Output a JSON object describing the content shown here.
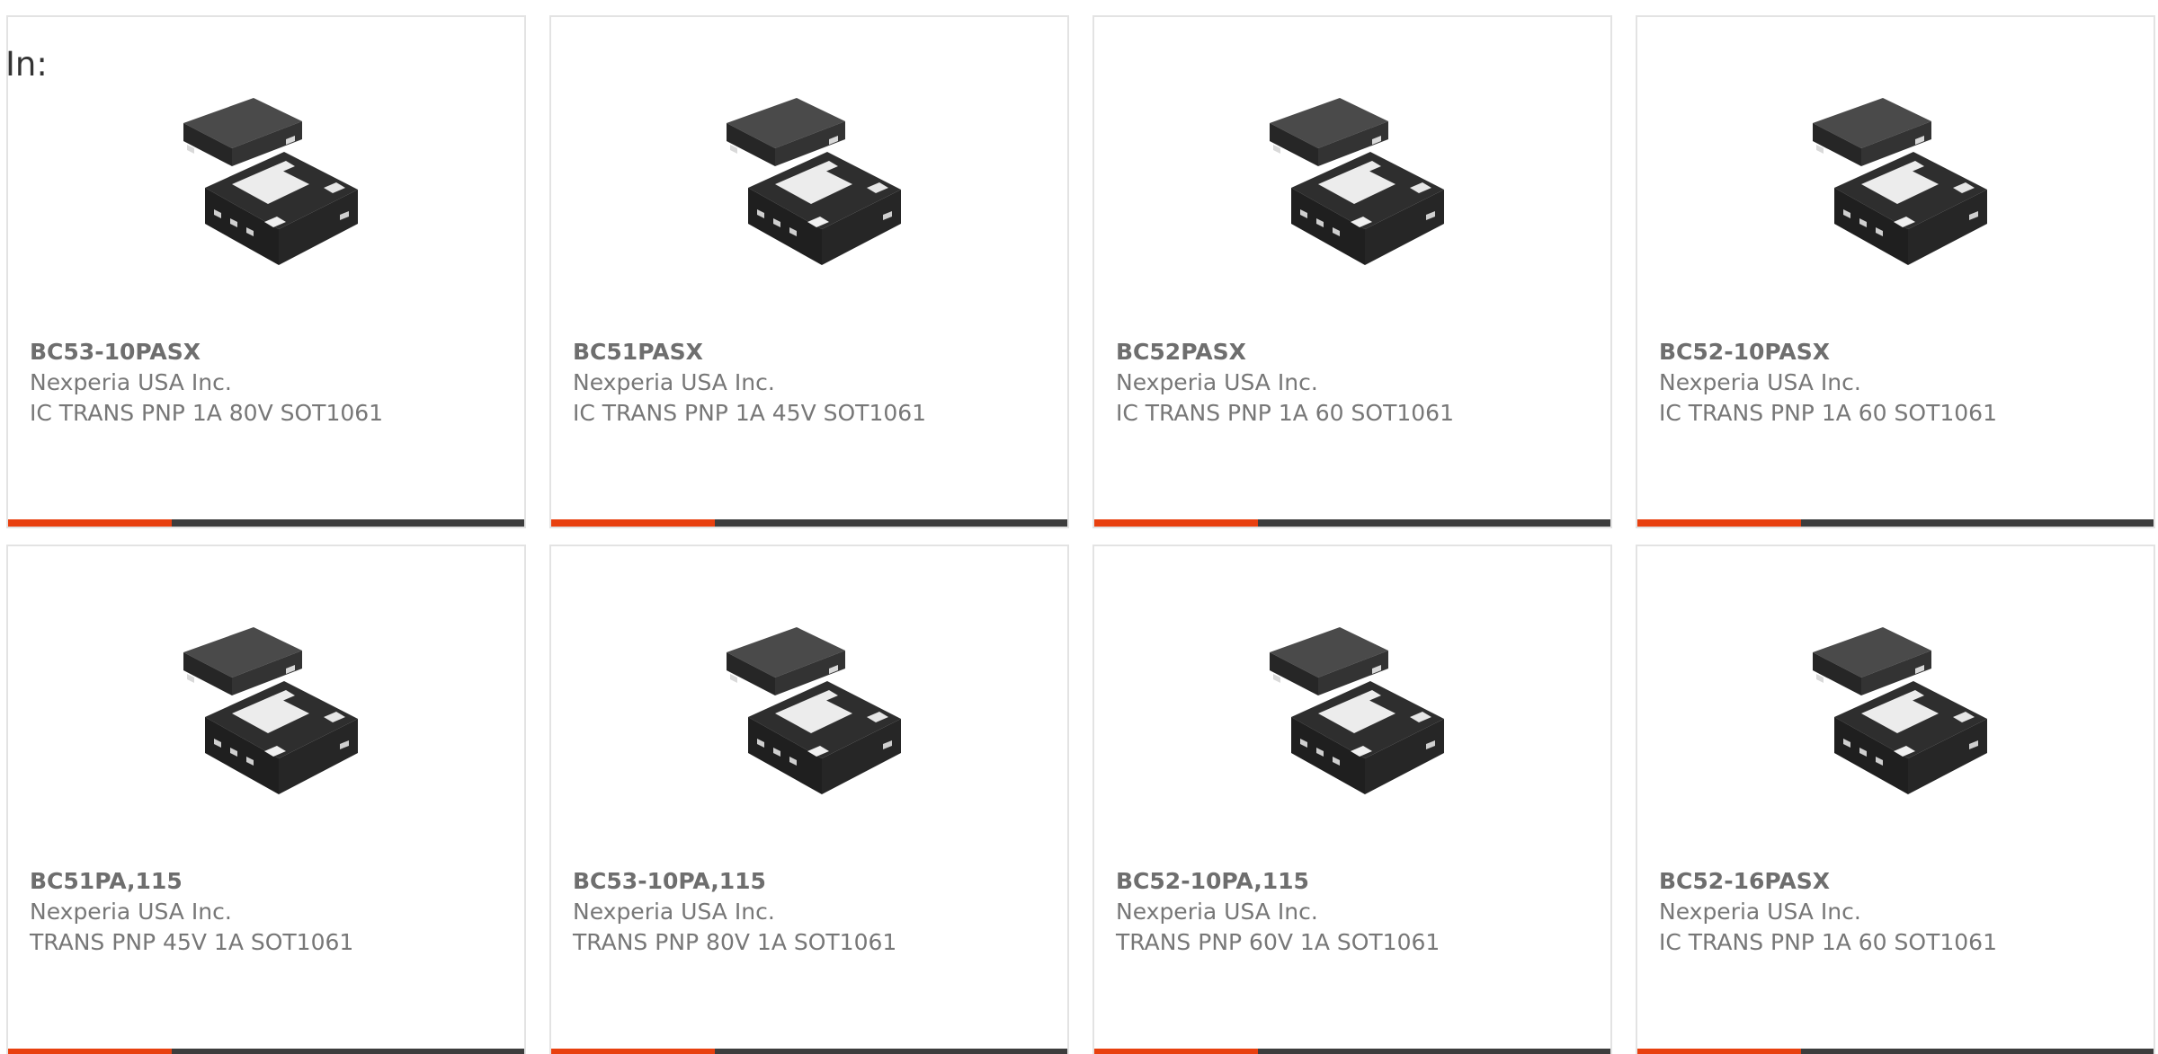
{
  "header": {
    "label": "In:"
  },
  "colors": {
    "accent": "#e8400f",
    "bar": "#3d3d3d",
    "chip_body": "#2b2b2b",
    "card_border": "#e3e3e3"
  },
  "products": [
    {
      "part_number": "BC53-10PASX",
      "manufacturer": "Nexperia USA Inc.",
      "description": "IC TRANS PNP 1A 80V SOT1061",
      "image_icon": "sot1061-package-icon"
    },
    {
      "part_number": "BC51PASX",
      "manufacturer": "Nexperia USA Inc.",
      "description": "IC TRANS PNP 1A 45V SOT1061",
      "image_icon": "sot1061-package-icon"
    },
    {
      "part_number": "BC52PASX",
      "manufacturer": "Nexperia USA Inc.",
      "description": "IC TRANS PNP 1A 60 SOT1061",
      "image_icon": "sot1061-package-icon"
    },
    {
      "part_number": "BC52-10PASX",
      "manufacturer": "Nexperia USA Inc.",
      "description": "IC TRANS PNP 1A 60 SOT1061",
      "image_icon": "sot1061-package-icon"
    },
    {
      "part_number": "BC51PA,115",
      "manufacturer": "Nexperia USA Inc.",
      "description": "TRANS PNP 45V 1A SOT1061",
      "image_icon": "sot1061-package-icon"
    },
    {
      "part_number": "BC53-10PA,115",
      "manufacturer": "Nexperia USA Inc.",
      "description": "TRANS PNP 80V 1A SOT1061",
      "image_icon": "sot1061-package-icon"
    },
    {
      "part_number": "BC52-10PA,115",
      "manufacturer": "Nexperia USA Inc.",
      "description": "TRANS PNP 60V 1A SOT1061",
      "image_icon": "sot1061-package-icon"
    },
    {
      "part_number": "BC52-16PASX",
      "manufacturer": "Nexperia USA Inc.",
      "description": "IC TRANS PNP 1A 60 SOT1061",
      "image_icon": "sot1061-package-icon"
    }
  ]
}
